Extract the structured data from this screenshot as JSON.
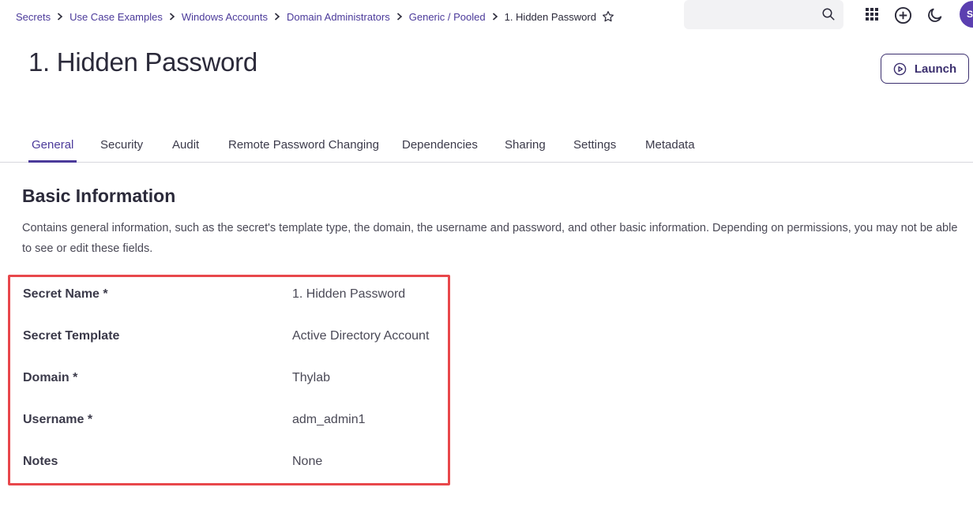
{
  "breadcrumb": {
    "items": [
      "Secrets",
      "Use Case Examples",
      "Windows Accounts",
      "Domain Administrators",
      "Generic / Pooled"
    ],
    "current": "1. Hidden Password"
  },
  "search": {
    "value": "",
    "placeholder": ""
  },
  "header_icons": [
    "apps-grid-icon",
    "add-circle-icon",
    "dark-mode-moon-icon"
  ],
  "avatar": {
    "initial": "S",
    "color": "#5b3fb0"
  },
  "page": {
    "title": "1. Hidden Password",
    "launch_label": "Launch"
  },
  "tabs": [
    {
      "label": "General",
      "active": true
    },
    {
      "label": "Security",
      "active": false
    },
    {
      "label": "Audit",
      "active": false
    },
    {
      "label": "Remote Password Changing",
      "active": false
    },
    {
      "label": "Dependencies",
      "active": false
    },
    {
      "label": "Sharing",
      "active": false
    },
    {
      "label": "Settings",
      "active": false
    },
    {
      "label": "Metadata",
      "active": false
    }
  ],
  "basic_info": {
    "title": "Basic Information",
    "description": "Contains general information, such as the secret's template type, the domain, the username and password, and other basic information. Depending on permissions, you may not be able to see or edit these fields.",
    "fields": [
      {
        "label": "Secret Name *",
        "value": "1. Hidden Password"
      },
      {
        "label": "Secret Template",
        "value": "Active Directory Account"
      },
      {
        "label": "Domain *",
        "value": "Thylab"
      },
      {
        "label": "Username *",
        "value": "adm_admin1"
      },
      {
        "label": "Notes",
        "value": "None"
      }
    ]
  },
  "colors": {
    "accent": "#4b3a9a",
    "highlight_border": "#e8474b",
    "text": "#2b2a3a"
  }
}
